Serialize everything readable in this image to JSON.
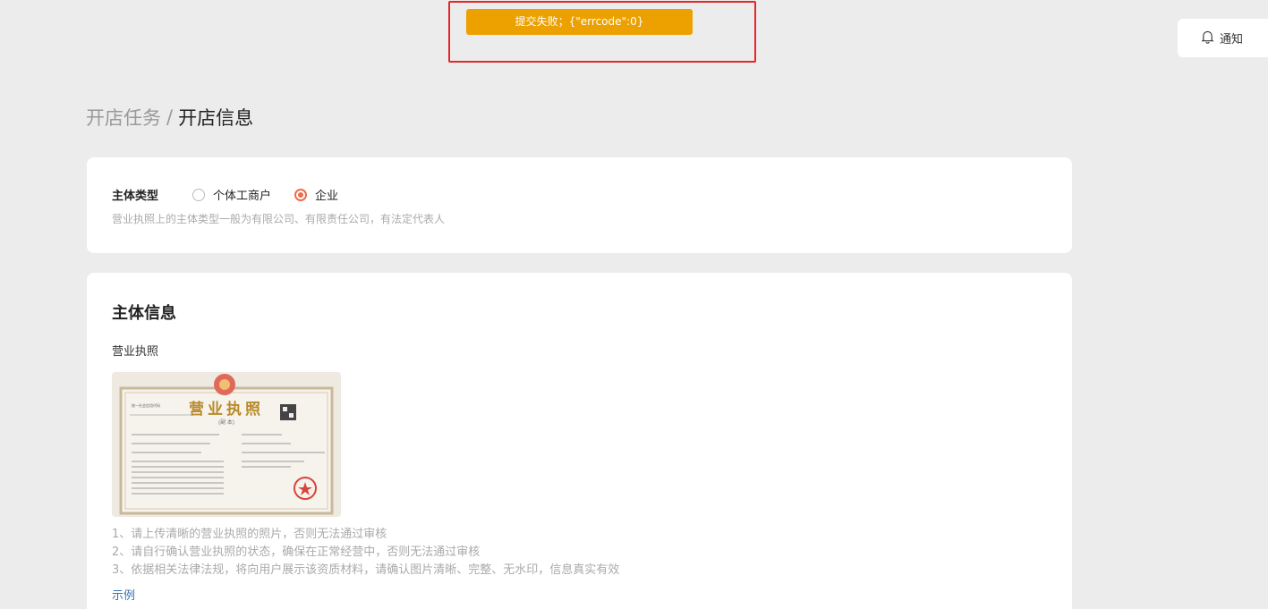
{
  "toast": {
    "message": "提交失败；{\"errcode\":0}"
  },
  "header": {
    "notice_label": "通知"
  },
  "breadcrumb": {
    "parent": "开店任务",
    "separator": "/",
    "current": "开店信息"
  },
  "entity_type": {
    "label": "主体类型",
    "options": [
      {
        "label": "个体工商户",
        "checked": false
      },
      {
        "label": "企业",
        "checked": true
      }
    ],
    "hint": "营业执照上的主体类型一般为有限公司、有限责任公司，有法定代表人"
  },
  "entity_info": {
    "title": "主体信息",
    "license_label": "营业执照",
    "license_image": {
      "title": "营业执照",
      "subtitle": "(副 本)",
      "top_left": "统一社会信用代码"
    },
    "notes": [
      "1、请上传清晰的营业执照的照片，否则无法通过审核",
      "2、请自行确认营业执照的状态，确保在正常经营中，否则无法通过审核",
      "3、依据相关法律法规，将向用户展示该资质材料，请确认图片清晰、完整、无水印，信息真实有效"
    ],
    "example_link": "示例"
  },
  "colors": {
    "toast": "#eca100",
    "accent": "#ef6b4a",
    "highlight": "#e5262a",
    "link": "#3a6fb5"
  }
}
